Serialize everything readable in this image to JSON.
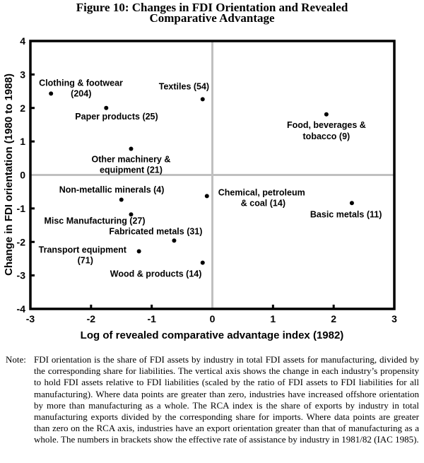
{
  "title": {
    "line1": "Figure 10: Changes in FDI Orientation and Revealed",
    "line2": "Comparative Advantage"
  },
  "chart_data": {
    "type": "scatter",
    "title": "Figure 10: Changes in FDI Orientation and Revealed Comparative Advantage",
    "xlabel": "Log of revealed comparative advantage index (1982)",
    "ylabel": "Change in FDI orientation (1980 to 1988)",
    "xlim": [
      -3,
      3
    ],
    "ylim": [
      -4,
      4
    ],
    "xticks": [
      "-3",
      "-2",
      "-1",
      "0",
      "1",
      "2",
      "3"
    ],
    "yticks": [
      "4",
      "3",
      "2",
      "1",
      "0",
      "-1",
      "-2",
      "-3",
      "-4"
    ],
    "grid": false,
    "zero_lines": true,
    "legend": "none",
    "point_color": "#000000",
    "zero_line_color": "#c0c0c0",
    "points": [
      {
        "name": "Clothing & footwear (204)",
        "label_lines": [
          "Clothing & footwear",
          "(204)"
        ],
        "x": -2.66,
        "y": 2.43
      },
      {
        "name": "Textiles (54)",
        "label_lines": [
          "Textiles (54)"
        ],
        "x": -0.16,
        "y": 2.26
      },
      {
        "name": "Paper products (25)",
        "label_lines": [
          "Paper products (25)"
        ],
        "x": -1.75,
        "y": 2.0
      },
      {
        "name": "Food, beverages & tobacco (9)",
        "label_lines": [
          "Food, beverages &",
          "tobacco (9)"
        ],
        "x": 1.88,
        "y": 1.81
      },
      {
        "name": "Other machinery & equipment (21)",
        "label_lines": [
          "Other machinery &",
          "equipment (21)"
        ],
        "x": -1.34,
        "y": 0.78
      },
      {
        "name": "Non-metallic minerals (4)",
        "label_lines": [
          "Non-metallic minerals (4)"
        ],
        "x": -1.5,
        "y": -0.74
      },
      {
        "name": "Chemical, petroleum & coal (14)",
        "label_lines": [
          "Chemical, petroleum",
          "& coal (14)"
        ],
        "x": -0.09,
        "y": -0.63
      },
      {
        "name": "Basic metals (11)",
        "label_lines": [
          "Basic metals (11)"
        ],
        "x": 2.3,
        "y": -0.84
      },
      {
        "name": "Misc Manufacturing (27)",
        "label_lines": [
          "Misc Manufacturing (27)"
        ],
        "x": -1.34,
        "y": -1.18
      },
      {
        "name": "Fabricated metals (31)",
        "label_lines": [
          "Fabricated metals (31)"
        ],
        "x": -0.63,
        "y": -1.96
      },
      {
        "name": "Transport equipment (71)",
        "label_lines": [
          "Transport equipment",
          "(71)"
        ],
        "x": -1.21,
        "y": -2.28
      },
      {
        "name": "Wood & products (14)",
        "label_lines": [
          "Wood &  products (14)"
        ],
        "x": -0.16,
        "y": -2.62
      }
    ]
  },
  "note": {
    "label": "Note:",
    "text": "FDI orientation is the share of FDI assets by industry in total FDI assets for manufacturing, divided by the corresponding share for liabilities. The vertical axis shows the change in each industry’s propensity to hold FDI assets relative to FDI liabilities (scaled by the ratio of FDI assets to FDI liabilities for all manufacturing). Where data points are greater than zero, industries have increased offshore orientation by more than manufacturing as a whole. The RCA index is the share of exports by industry in total manufacturing exports divided by the corresponding share for imports. Where data points are greater than zero on the RCA axis, industries have an export orientation greater than that of manufacturing as a whole. The numbers in brackets show the effective rate of assistance by industry in 1981/82 (IAC 1985)."
  }
}
